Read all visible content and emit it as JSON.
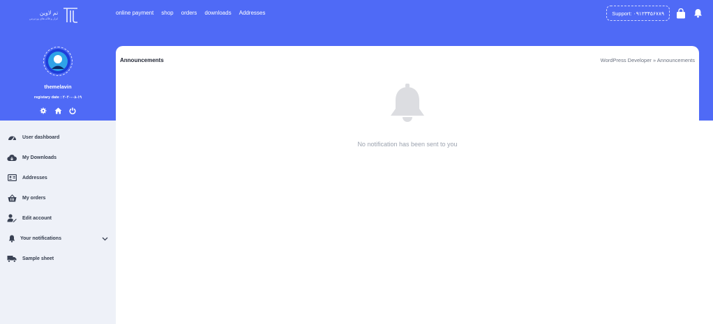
{
  "header": {
    "logo": {
      "main_text": "تم لاوین",
      "sub_text": "ابزار و قالب‌های وردپرس",
      "icon": "brand-logo-icon"
    },
    "nav": [
      "online payment",
      "shop",
      "orders",
      "downloads",
      "Addresses"
    ],
    "support_label": "Support: ۰۹۱۲۳۴۵۶۷۸۹",
    "icons": [
      "shopping-bag-icon",
      "bell-icon"
    ]
  },
  "profile": {
    "username": "themelavin",
    "registry_date": "registary date : ۲۰۲۰-۰۸-۱۹",
    "actions": [
      "gear-icon",
      "home-icon",
      "power-icon"
    ]
  },
  "sidebar": {
    "items": [
      {
        "label": "User dashboard",
        "icon": "dashboard-icon"
      },
      {
        "label": "My Downloads",
        "icon": "cloud-download-icon"
      },
      {
        "label": "Addresses",
        "icon": "address-card-icon"
      },
      {
        "label": "My orders",
        "icon": "basket-icon"
      },
      {
        "label": "Edit account",
        "icon": "user-edit-icon"
      },
      {
        "label": "Your notifications",
        "icon": "bell-icon",
        "expandable": true
      },
      {
        "label": "Sample sheet",
        "icon": "truck-icon"
      }
    ]
  },
  "main": {
    "title": "Announcements",
    "breadcrumb": "WordPress Developer » Announcements",
    "empty_message": "No notification has been sent to you",
    "empty_icon": "bell-icon"
  },
  "colors": {
    "brand": "#4f6af6",
    "sidebar_bg": "#eef1f8",
    "muted_icon": "#d9dbe0",
    "empty_text": "#9ca3af"
  }
}
